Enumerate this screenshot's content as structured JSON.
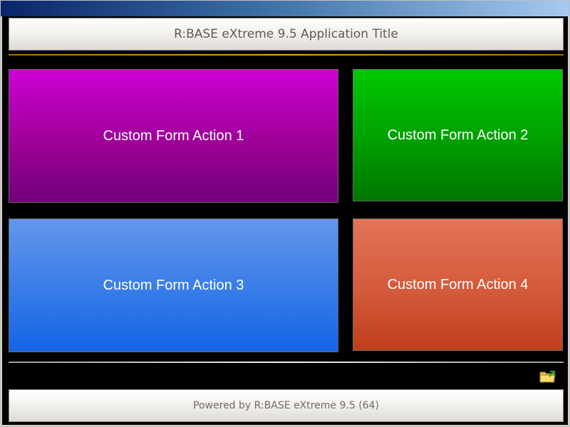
{
  "header": {
    "title": "R:BASE eXtreme 9.5 Application Title"
  },
  "actions": [
    {
      "label": "Custom Form Action 1",
      "color": "#b000c0"
    },
    {
      "label": "Custom Form Action 2",
      "color": "#00a800"
    },
    {
      "label": "Custom Form Action 3",
      "color": "#3a7ee8"
    },
    {
      "label": "Custom Form Action 4",
      "color": "#d35a3a"
    }
  ],
  "toolbar": {
    "icon": "folder-icon"
  },
  "footer": {
    "text": "Powered by R:BASE eXtreme 9.5 (64)"
  },
  "theme": {
    "accent_line": "#f0a030",
    "background": "#000000"
  }
}
